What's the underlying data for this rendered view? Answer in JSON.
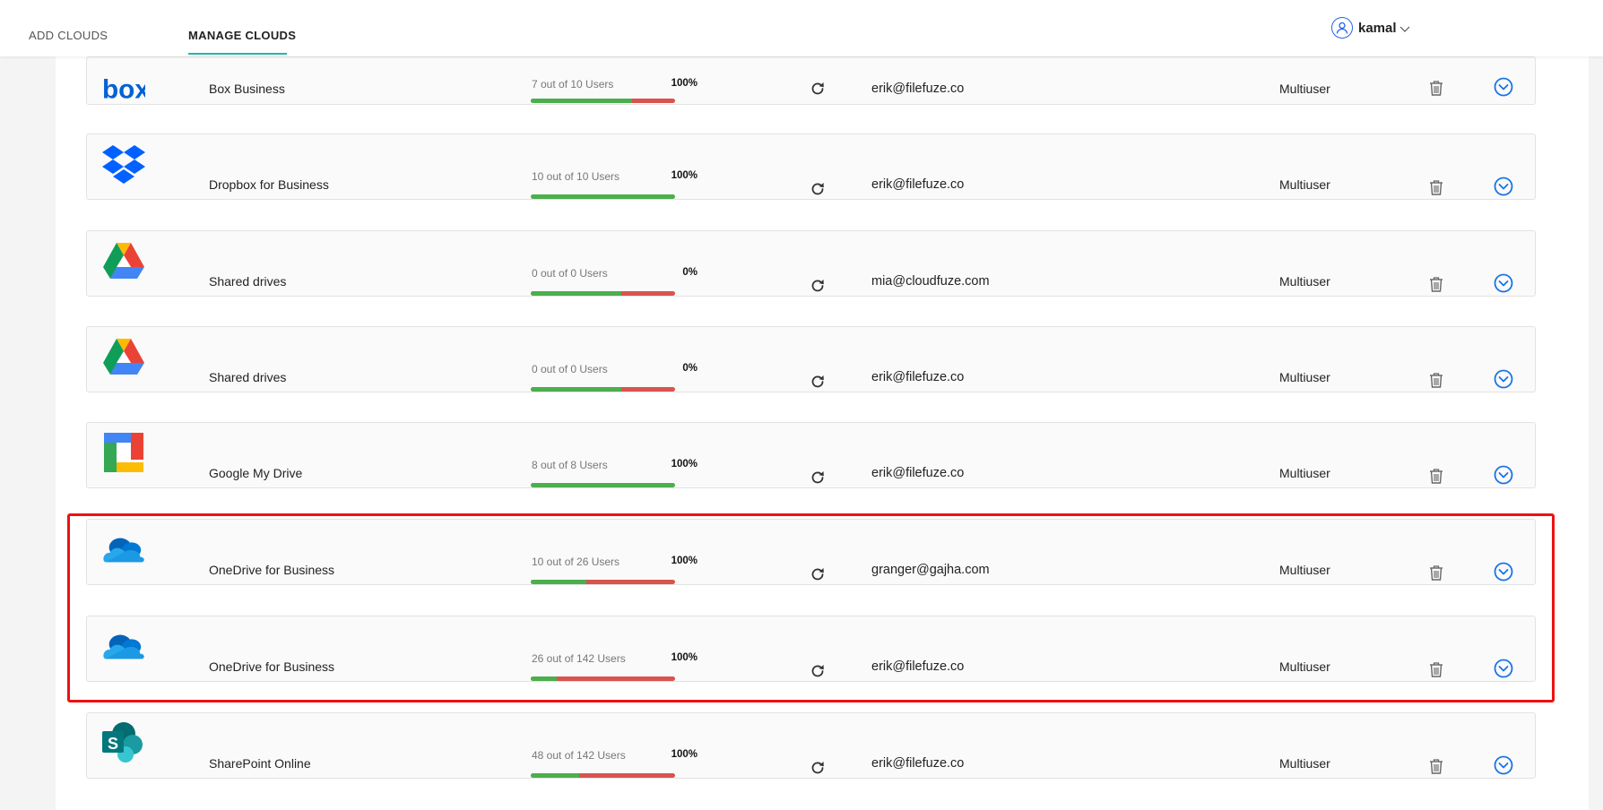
{
  "nav": {
    "tabs": [
      {
        "label": "ADD CLOUDS"
      },
      {
        "label": "MANAGE CLOUDS",
        "active": true
      }
    ],
    "user": {
      "name": "kamal",
      "icon": "user-icon"
    }
  },
  "colors": {
    "accent": "#27b3a8",
    "progress_green": "#4cae4c",
    "progress_red": "#d9534f",
    "action_blue": "#1a73e8",
    "highlight": "#ee1111"
  },
  "clouds": [
    {
      "logo": "box-logo",
      "name": "Box Business",
      "users": "7 out of 10 Users",
      "percent": "100%",
      "progress_fraction": 0.7,
      "email": "erik@filefuze.co",
      "type": "Multiuser"
    },
    {
      "logo": "dropbox-logo",
      "name": "Dropbox for Business",
      "users": "10 out of 10 Users",
      "percent": "100%",
      "progress_fraction": 1.0,
      "email": "erik@filefuze.co",
      "type": "Multiuser"
    },
    {
      "logo": "google-drive-logo",
      "name": "Shared drives",
      "users": "0 out of 0 Users",
      "percent": "0%",
      "progress_fraction": 0.63,
      "email": "mia@cloudfuze.com",
      "type": "Multiuser"
    },
    {
      "logo": "google-drive-logo",
      "name": "Shared drives",
      "users": "0 out of 0 Users",
      "percent": "0%",
      "progress_fraction": 0.63,
      "email": "erik@filefuze.co",
      "type": "Multiuser"
    },
    {
      "logo": "google-my-drive-logo",
      "name": "Google My Drive",
      "users": "8 out of 8 Users",
      "percent": "100%",
      "progress_fraction": 1.0,
      "email": "erik@filefuze.co",
      "type": "Multiuser"
    },
    {
      "logo": "onedrive-logo",
      "name": "OneDrive for Business",
      "users": "10 out of 26 Users",
      "percent": "100%",
      "progress_fraction": 0.385,
      "email": "granger@gajha.com",
      "type": "Multiuser"
    },
    {
      "logo": "onedrive-logo",
      "name": "OneDrive for Business",
      "users": "26 out of 142 Users",
      "percent": "100%",
      "progress_fraction": 0.183,
      "email": "erik@filefuze.co",
      "type": "Multiuser"
    },
    {
      "logo": "sharepoint-logo",
      "name": "SharePoint Online",
      "users": "48 out of 142 Users",
      "percent": "100%",
      "progress_fraction": 0.338,
      "email": "erik@filefuze.co",
      "type": "Multiuser"
    }
  ]
}
